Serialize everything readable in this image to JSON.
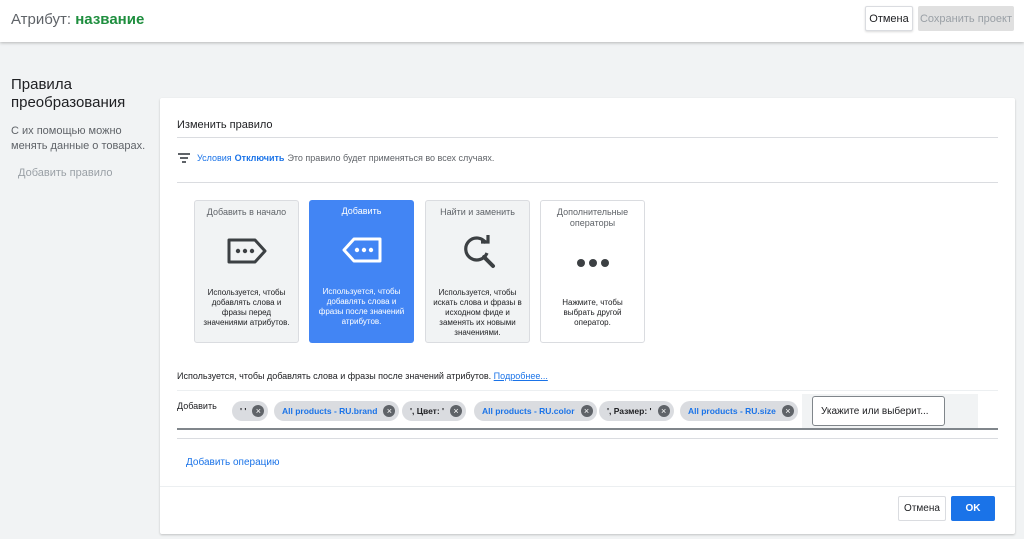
{
  "header": {
    "title_prefix": "Атрибут:",
    "attribute_name": "название",
    "cancel_label": "Отмена",
    "save_label": "Сохранить проект"
  },
  "left_panel": {
    "heading": "Правила преобразования",
    "description": "С их помощью можно менять данные о товарах.",
    "add_rule_label": "Добавить правило"
  },
  "card": {
    "edit_title": "Изменить правило",
    "conditions": {
      "icon": "filter-icon",
      "label": "Условия",
      "disable_label": "Отключить",
      "text": "Это правило будет применяться во всех случаях."
    },
    "operators": [
      {
        "title": "Добавить в начало",
        "icon": "prepend-tag-icon",
        "description": "Используется, чтобы добавлять слова и фразы перед значениями атрибутов.",
        "active": false
      },
      {
        "title": "Добавить",
        "icon": "append-tag-icon",
        "description": "Используется, чтобы добавлять слова и фразы после значений атрибутов.",
        "active": true
      },
      {
        "title": "Найти и заменить",
        "icon": "find-replace-icon",
        "description": "Используется, чтобы искать слова и фразы в исходном фиде и заменять их новыми значениями.",
        "active": false
      },
      {
        "title": "Дополнительные операторы",
        "icon": "more-horiz-icon",
        "description": "Нажмите, чтобы выбрать другой оператор.",
        "active": false
      }
    ],
    "usage_text": "Используется, чтобы добавлять слова и фразы после значений атрибутов.",
    "learn_more": "Подробнее...",
    "add_row": {
      "label": "Добавить",
      "chips": [
        {
          "text": "' '",
          "type": "text"
        },
        {
          "text": "All products - RU.brand",
          "type": "attribute"
        },
        {
          "text": "', Цвет: '",
          "type": "text"
        },
        {
          "text": "All products - RU.color",
          "type": "attribute"
        },
        {
          "text": "', Размер: '",
          "type": "text"
        },
        {
          "text": "All products - RU.size",
          "type": "attribute"
        }
      ],
      "input_placeholder": "Укажите или выберит..."
    },
    "add_operation": "Добавить операцию",
    "cancel_label": "Отмена",
    "ok_label": "OK"
  },
  "colors": {
    "accent": "#1a73e8",
    "active_tile": "#4285f4",
    "attribute_green": "#1e8e3e"
  }
}
